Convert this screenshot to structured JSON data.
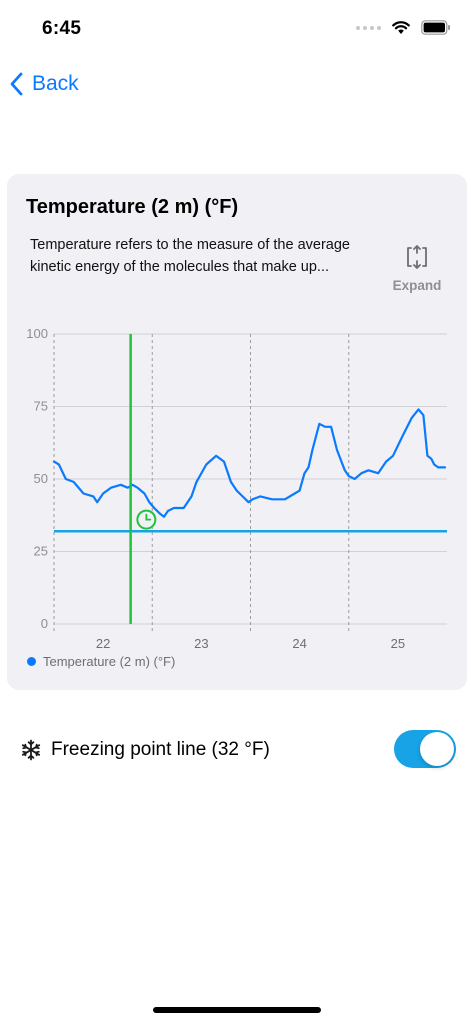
{
  "status_bar": {
    "time": "6:45",
    "icons": [
      "signal-dots-icon",
      "wifi-icon",
      "battery-icon"
    ]
  },
  "nav": {
    "back_label": "Back",
    "icon": "chevron-left-icon"
  },
  "card": {
    "title": "Temperature (2 m) (°F)",
    "description": "Temperature refers to the measure of the average kinetic energy of the molecules that make up...",
    "expand_label": "Expand",
    "expand_icon": "expand-icon"
  },
  "chart_data": {
    "type": "line",
    "ylim": [
      0,
      100
    ],
    "yticks": [
      0,
      25,
      50,
      75,
      100
    ],
    "xlim": [
      21.5,
      25.5
    ],
    "xticks": [
      22,
      23,
      24,
      25
    ],
    "xtick_labels": [
      "22",
      "23",
      "24",
      "25"
    ],
    "day_boundaries": [
      21.5,
      22.5,
      23.5,
      24.5
    ],
    "grid": "horizontal solid, vertical dashed at day boundaries",
    "legend_position": "bottom-left",
    "series": [
      {
        "name": "Temperature (2 m) (°F)",
        "color": "#0a7aff",
        "x": [
          21.5,
          21.55,
          21.62,
          21.7,
          21.8,
          21.9,
          21.94,
          22.0,
          22.08,
          22.18,
          22.25,
          22.3,
          22.35,
          22.42,
          22.47,
          22.52,
          22.58,
          22.62,
          22.66,
          22.72,
          22.82,
          22.9,
          22.95,
          23.05,
          23.15,
          23.23,
          23.3,
          23.36,
          23.42,
          23.48,
          23.52,
          23.6,
          23.72,
          23.85,
          23.95,
          24.0,
          24.05,
          24.09,
          24.13,
          24.2,
          24.26,
          24.32,
          24.38,
          24.46,
          24.5,
          24.56,
          24.63,
          24.7,
          24.8,
          24.88,
          24.95,
          25.05,
          25.14,
          25.21,
          25.26,
          25.3,
          25.34,
          25.37,
          25.41,
          25.44,
          25.48
        ],
        "y": [
          56,
          55,
          50,
          49,
          45,
          44,
          42,
          45,
          47,
          48,
          47,
          48,
          47,
          45,
          42,
          40,
          38,
          37,
          39,
          40,
          40,
          44,
          49,
          55,
          58,
          56,
          49,
          46,
          44,
          42,
          43,
          44,
          43,
          43,
          45,
          46,
          52,
          54,
          60,
          69,
          68,
          68,
          60,
          53,
          51,
          50,
          52,
          53,
          52,
          56,
          58,
          65,
          71,
          74,
          72,
          58,
          57,
          55,
          54,
          54,
          54
        ],
        "values": [
          56,
          55,
          50,
          49,
          45,
          44,
          42,
          45,
          47,
          48,
          47,
          48,
          47,
          45,
          42,
          40,
          38,
          37,
          39,
          40,
          40,
          44,
          49,
          55,
          58,
          56,
          49,
          46,
          44,
          42,
          43,
          44,
          43,
          43,
          45,
          46,
          52,
          54,
          60,
          69,
          68,
          68,
          60,
          53,
          51,
          50,
          52,
          53,
          52,
          56,
          58,
          65,
          71,
          74,
          72,
          58,
          57,
          55,
          54,
          54,
          54
        ]
      }
    ],
    "freezing_line": {
      "y": 32,
      "color": "#17a3e6"
    },
    "cursor_line": {
      "x": 22.28,
      "color": "#21c23c"
    },
    "clock_marker": {
      "x": 22.44,
      "y": 36,
      "icon": "clock-icon",
      "color": "#21c23c"
    }
  },
  "legend": {
    "label": "Temperature (2 m) (°F)"
  },
  "setting": {
    "label": "Freezing point line (32 °F)",
    "icon": "snowflake-icon",
    "toggle_on": true
  },
  "colors": {
    "accent": "#0a7aff",
    "card_bg": "#f0f0f5",
    "toggle_on": "#17a3e6",
    "cursor": "#21c23c"
  }
}
